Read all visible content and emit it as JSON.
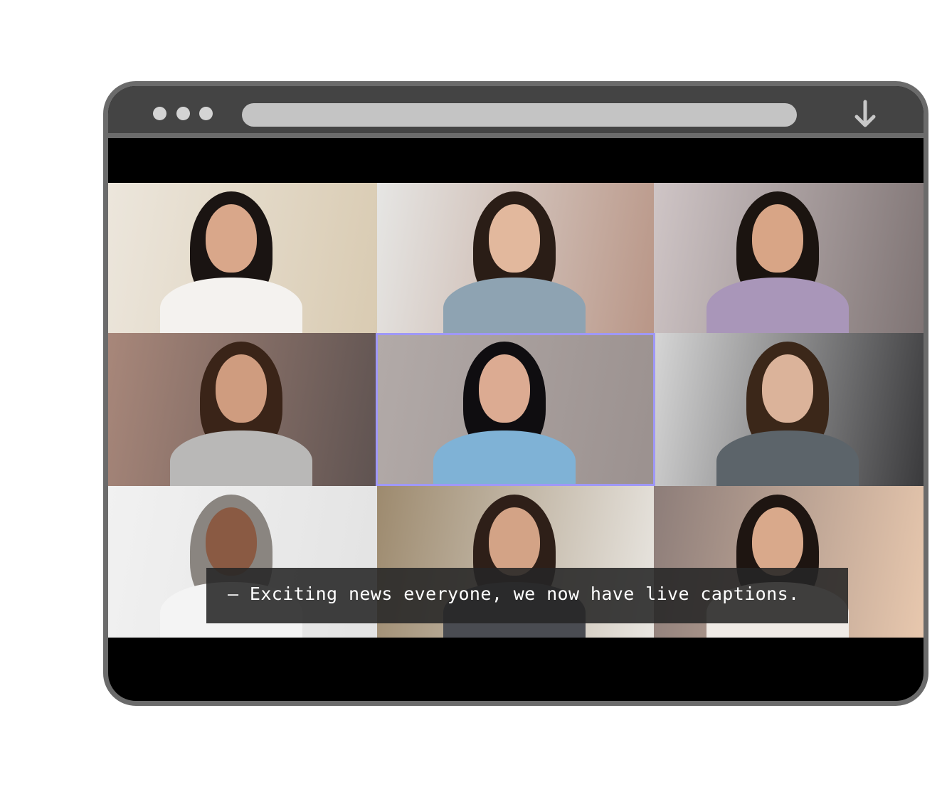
{
  "window": {
    "controls": [
      "dot-1",
      "dot-2",
      "dot-3"
    ],
    "address_bar_value": "",
    "download_icon": "arrow-down-icon"
  },
  "colors": {
    "frame": "#6b6b6b",
    "toolbar": "#444444",
    "address_bar": "#c4c4c4",
    "active_speaker_border": "#9f98f7",
    "caption_bg": "#262626"
  },
  "meeting": {
    "grid": "3x3",
    "active_speaker_index": 4,
    "participants": [
      {
        "label": "participant-1",
        "hair": "#1a1412",
        "skin": "#d9a78a",
        "top": "#f4f2ef",
        "bg_a": "#ece6dc",
        "bg_b": "#d9cbb2"
      },
      {
        "label": "participant-2",
        "hair": "#2a1d16",
        "skin": "#e2b89d",
        "top": "#8ea3b2",
        "bg_a": "#e6e6e4",
        "bg_b": "#b99687"
      },
      {
        "label": "participant-3",
        "hair": "#1b1410",
        "skin": "#d8a586",
        "top": "#a996b9",
        "bg_a": "#cfc5c6",
        "bg_b": "#7f7474"
      },
      {
        "label": "participant-4",
        "hair": "#3a2418",
        "skin": "#cf9c7f",
        "top": "#b9b8b7",
        "bg_a": "#a8877a",
        "bg_b": "#5f5351"
      },
      {
        "label": "participant-5",
        "hair": "#0f0d10",
        "skin": "#dcab92",
        "top": "#7fb2d6",
        "bg_a": "#b2aaa8",
        "bg_b": "#9b918f"
      },
      {
        "label": "participant-6",
        "hair": "#3b2719",
        "skin": "#dbb39a",
        "top": "#5c646a",
        "bg_a": "#d6d6d6",
        "bg_b": "#3a3a3c"
      },
      {
        "label": "participant-7",
        "hair": "#8a8580",
        "skin": "#8a5a43",
        "top": "#f4f4f4",
        "bg_a": "#f1f1f1",
        "bg_b": "#e3e3e3"
      },
      {
        "label": "participant-8",
        "hair": "#2e1f18",
        "skin": "#d3a386",
        "top": "#4a4c52",
        "bg_a": "#9d8a6e",
        "bg_b": "#e9e6e1"
      },
      {
        "label": "participant-9",
        "hair": "#1e1511",
        "skin": "#d9a98b",
        "top": "#f0ebe6",
        "bg_a": "#8d7d79",
        "bg_b": "#e8c8ae"
      }
    ]
  },
  "caption": {
    "text": "– Exciting news everyone, we now have live captions."
  }
}
